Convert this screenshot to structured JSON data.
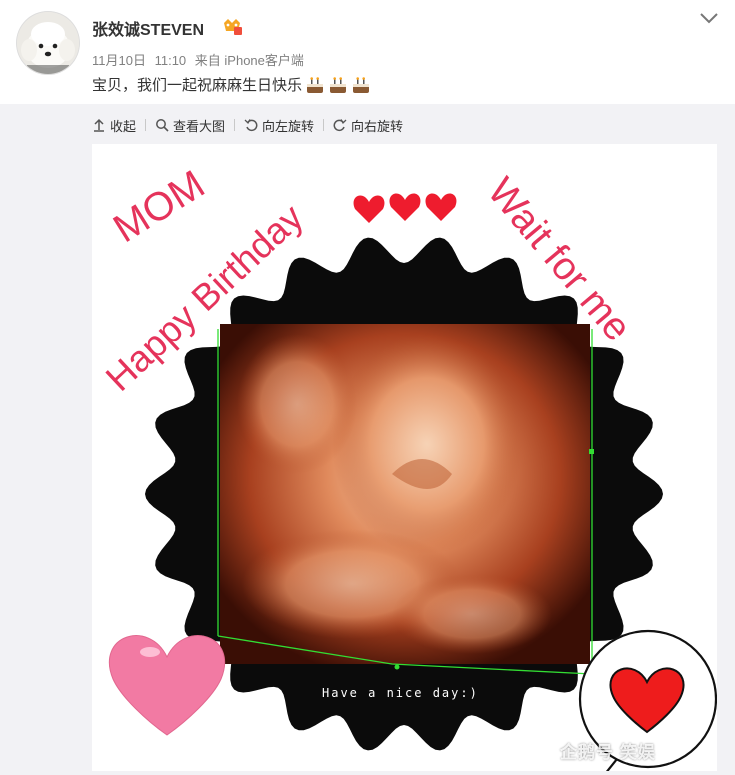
{
  "post": {
    "username": "张效诚STEVEN",
    "date": "11月10日",
    "time": "11:10",
    "source": "来自 iPhone客户端",
    "text": "宝贝，我们一起祝麻麻生日快乐",
    "emoji_icons": [
      "cake-icon",
      "cake-icon",
      "cake-icon"
    ]
  },
  "toolbar": {
    "collapse": "收起",
    "view_large": "查看大图",
    "rotate_left": "向左旋转",
    "rotate_right": "向右旋转"
  },
  "image": {
    "text_mom": "MOM",
    "text_birthday": "Happy Birthday",
    "text_wait": "Wait for me",
    "text_nice_day": "Have a nice day:)",
    "accent_color": "#e5335b"
  },
  "watermark": "企鹅号 笑娱"
}
